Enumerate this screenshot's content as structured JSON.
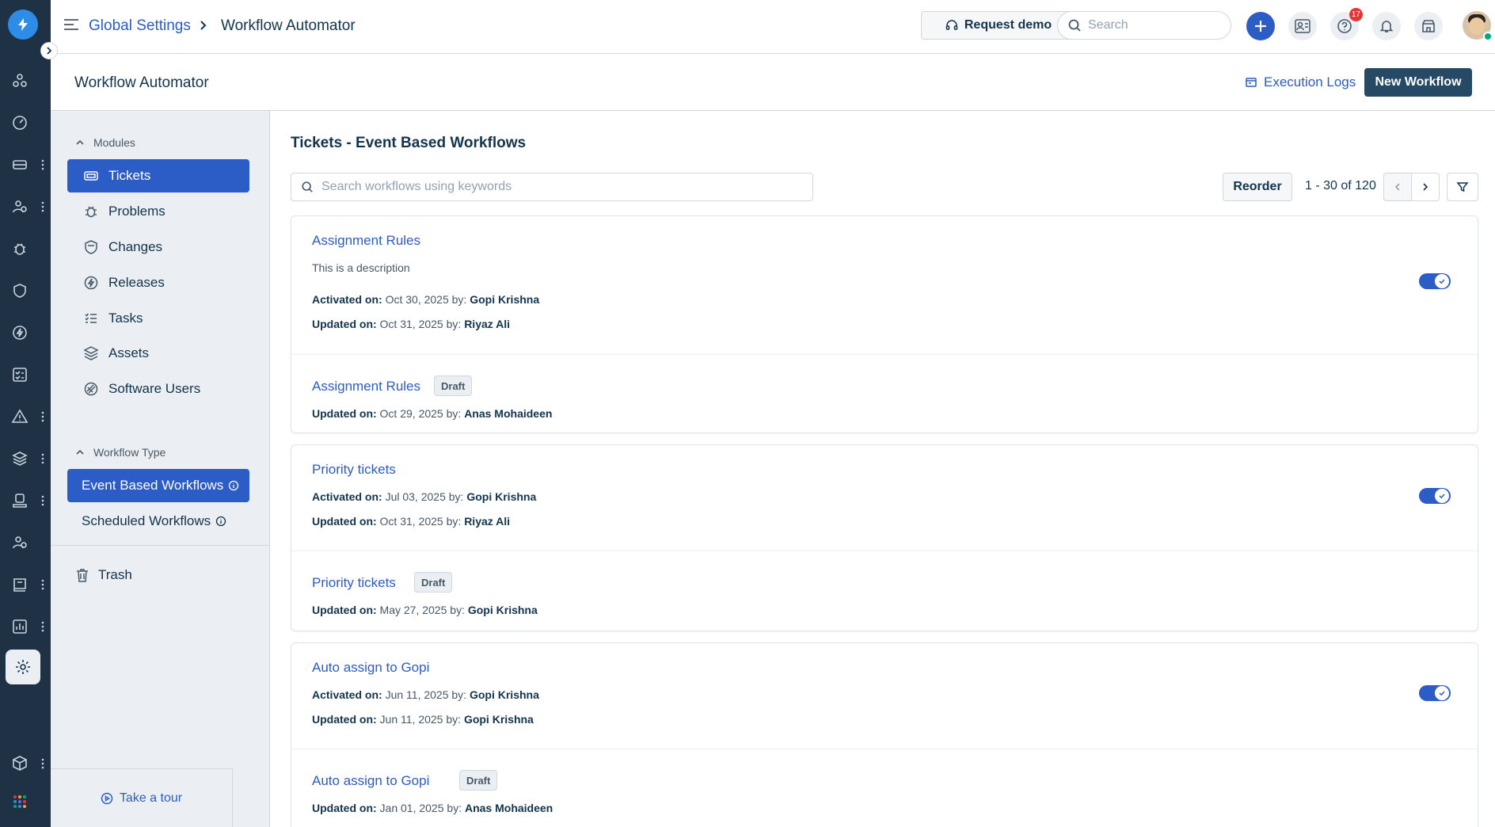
{
  "breadcrumb": {
    "parent": "Global Settings",
    "current": "Workflow Automator"
  },
  "header": {
    "request_demo": "Request demo",
    "search_placeholder": "Search",
    "notification_count": "17"
  },
  "page": {
    "title": "Workflow Automator",
    "execution_logs": "Execution Logs",
    "new_workflow": "New Workflow"
  },
  "sidebar": {
    "modules_heading": "Modules",
    "modules": [
      {
        "label": "Tickets",
        "icon": "ticket-icon",
        "active": true
      },
      {
        "label": "Problems",
        "icon": "bug-icon"
      },
      {
        "label": "Changes",
        "icon": "shield-icon"
      },
      {
        "label": "Releases",
        "icon": "release-icon"
      },
      {
        "label": "Tasks",
        "icon": "tasks-icon"
      },
      {
        "label": "Assets",
        "icon": "layers-icon"
      },
      {
        "label": "Software Users",
        "icon": "software-icon"
      }
    ],
    "workflow_type_heading": "Workflow Type",
    "workflow_types": [
      {
        "label": "Event Based Workflows",
        "active": true
      },
      {
        "label": "Scheduled Workflows"
      }
    ],
    "trash": "Trash",
    "take_tour": "Take a tour"
  },
  "main": {
    "title": "Tickets - Event Based Workflows",
    "search_placeholder": "Search workflows using keywords",
    "reorder": "Reorder",
    "pagination": "1 - 30 of 120",
    "labels": {
      "activated_on": "Activated on:",
      "updated_on": "Updated on:",
      "by": "by:",
      "draft": "Draft"
    },
    "workflows": [
      {
        "live": {
          "name": "Assignment Rules",
          "description": "This is a description",
          "activated_date": "Oct 30, 2025",
          "activated_by": "Gopi Krishna",
          "updated_date": "Oct 31, 2025",
          "updated_by": "Riyaz Ali",
          "enabled": true
        },
        "draft": {
          "name": "Assignment Rules",
          "updated_date": "Oct 29, 2025",
          "updated_by": "Anas Mohaideen"
        }
      },
      {
        "live": {
          "name": "Priority tickets",
          "activated_date": "Jul 03, 2025",
          "activated_by": "Gopi Krishna",
          "updated_date": "Oct 31, 2025",
          "updated_by": "Riyaz Ali",
          "enabled": true
        },
        "draft": {
          "name": "Priority tickets",
          "updated_date": "May 27, 2025",
          "updated_by": "Gopi Krishna"
        }
      },
      {
        "live": {
          "name": "Auto assign to Gopi",
          "activated_date": "Jun 11, 2025",
          "activated_by": "Gopi Krishna",
          "updated_date": "Jun 11, 2025",
          "updated_by": "Gopi Krishna",
          "enabled": true
        },
        "draft": {
          "name": "Auto assign to Gopi",
          "updated_date": "Jan 01, 2025",
          "updated_by": "Anas Mohaideen"
        }
      }
    ]
  },
  "colors": {
    "rail": "#1f3145",
    "accent": "#2c5cc5",
    "primary_button": "#264966",
    "sidebar_bg": "#ebeff3",
    "badge": "#e43538"
  }
}
